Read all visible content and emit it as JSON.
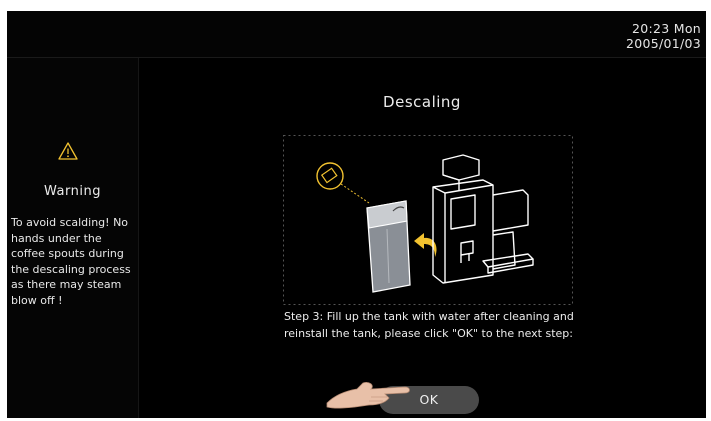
{
  "status": {
    "time": "20:23  Mon",
    "date": "2005/01/03"
  },
  "warning": {
    "title": "Warning",
    "text": "To avoid scalding! No hands under the coffee spouts during the descaling process as there may steam blow off !"
  },
  "main": {
    "title": "Descaling",
    "step_text": "Step 3: Fill up the tank with water after cleaning and reinstall the tank, please click \"OK\" to the next step:",
    "ok_label": "OK"
  },
  "colors": {
    "accent": "#f2c230",
    "background": "#000000",
    "button": "#4a4a4a"
  },
  "icons": [
    "warning-icon",
    "pour-water-icon",
    "water-tank-illustration",
    "coffee-machine-illustration",
    "insert-arrow-icon",
    "pointing-hand-icon"
  ]
}
